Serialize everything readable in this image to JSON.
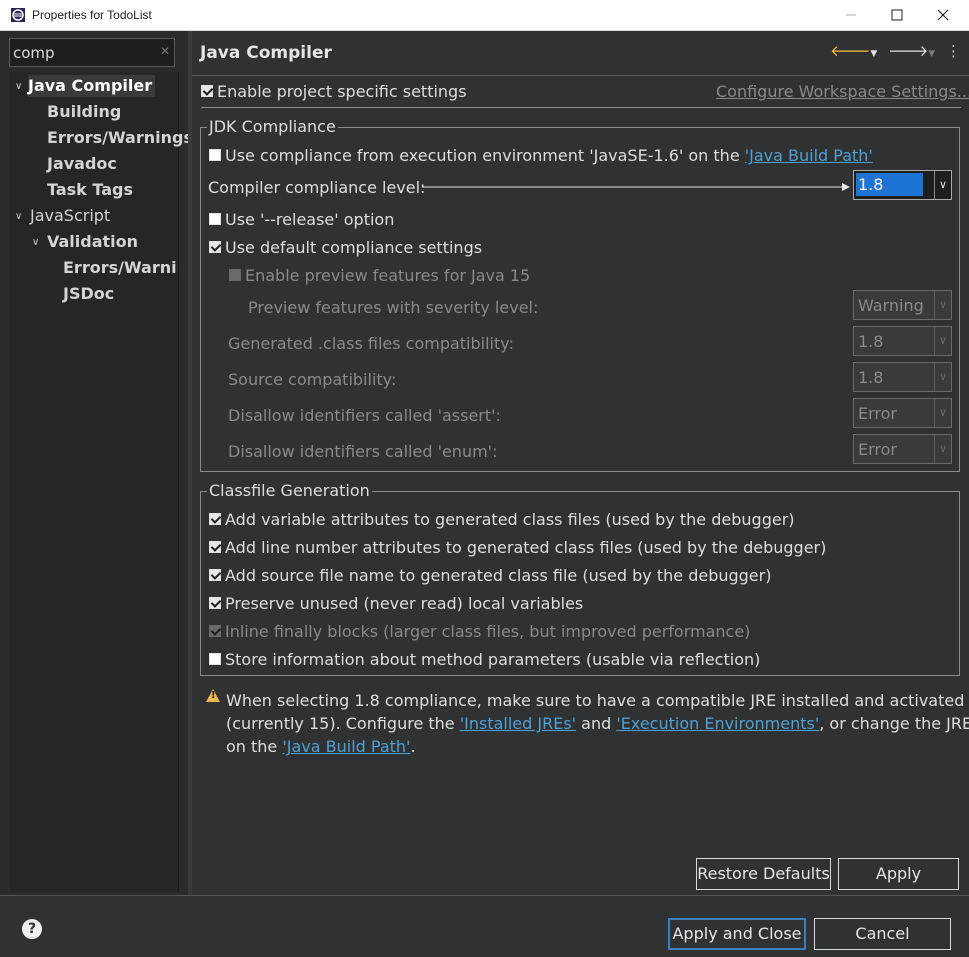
{
  "window": {
    "title": "Properties for TodoList"
  },
  "filter": {
    "value": "comp"
  },
  "tree": {
    "items": [
      {
        "label": "Java Compiler"
      },
      {
        "label": "Building"
      },
      {
        "label": "Errors/Warnings"
      },
      {
        "label": "Javadoc"
      },
      {
        "label": "Task Tags"
      },
      {
        "label": "JavaScript"
      },
      {
        "label": "Validation"
      },
      {
        "label": "Errors/Warnin"
      },
      {
        "label": "JSDoc"
      }
    ]
  },
  "page": {
    "title": "Java Compiler",
    "enable_project_specific": "Enable project specific settings",
    "configure_workspace": "Configure Workspace Settings..."
  },
  "jdk": {
    "group_title": "JDK Compliance",
    "use_compliance_prefix": "Use compliance from execution environment 'JavaSE-1.6' on the ",
    "java_build_path_link": "'Java Build Path'",
    "compliance_level_label": "Compiler compliance level:",
    "compliance_level_value": "1.8",
    "release_option": "Use '--release' option",
    "default_settings": "Use default compliance settings",
    "preview_features": "Enable preview features for Java 15",
    "preview_severity_label": "Preview features with severity level:",
    "preview_severity_value": "Warning",
    "generated_class_label": "Generated .class files compatibility:",
    "generated_class_value": "1.8",
    "source_compat_label": "Source compatibility:",
    "source_compat_value": "1.8",
    "assert_label": "Disallow identifiers called 'assert':",
    "assert_value": "Error",
    "enum_label": "Disallow identifiers called 'enum':",
    "enum_value": "Error"
  },
  "classfile": {
    "group_title": "Classfile Generation",
    "options": [
      "Add variable attributes to generated class files (used by the debugger)",
      "Add line number attributes to generated class files (used by the debugger)",
      "Add source file name to generated class file (used by the debugger)",
      "Preserve unused (never read) local variables",
      "Inline finally blocks (larger class files, but improved performance)",
      "Store information about method parameters (usable via reflection)"
    ]
  },
  "warning": {
    "line1": "When selecting 1.8 compliance, make sure to have a compatible JRE installed and activated",
    "line2_prefix": "(currently 15). Configure the ",
    "installed_jres_link": "'Installed JREs'",
    "line2_and": " and ",
    "exec_env_link": "'Execution Environments'",
    "line2_suffix": ", or change the JRE",
    "line3_prefix": "on the ",
    "java_build_path_link": "'Java Build Path'",
    "line3_suffix": "."
  },
  "buttons": {
    "restore_defaults": "Restore Defaults",
    "apply": "Apply",
    "apply_and_close": "Apply and Close",
    "cancel": "Cancel"
  },
  "colors": {
    "background": "#2f3132",
    "link": "#4ea1d3",
    "selection": "#1e74d4",
    "warning": "#e8b84a"
  }
}
